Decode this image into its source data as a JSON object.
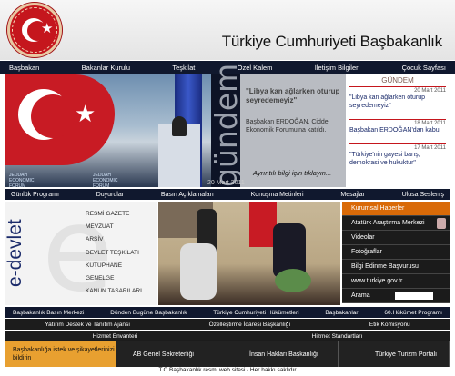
{
  "header": {
    "title": "Türkiye Cumhuriyeti Başbakanlık"
  },
  "nav": [
    "Başbakan",
    "Bakanlar Kurulu",
    "Teşkilat",
    "Özel Kalem",
    "İletişim Bilgileri",
    "Çocuk Sayfası"
  ],
  "gundem": {
    "vertical": "gündem",
    "headline": "\"Libya kan ağlarken oturup seyredemeyiz\"",
    "summary": "Başbakan ERDOĞAN, Cidde Ekonomik Forumu'na katıldı.",
    "more": "Ayrıntılı bilgi için tıklayın...",
    "date": "20 Mart 2011",
    "side_label": "GÜNDEM",
    "items": [
      {
        "date": "20 Mart 2011",
        "text": "\"Libya kan ağlarken oturup seyredemeyiz\""
      },
      {
        "date": "18 Mart 2011",
        "text": "Başbakan ERDOĞAN'dan kabul"
      },
      {
        "date": "17 Mart 2011",
        "text": "\"Türkiye'nin gayesi barış, demokrasi ve hukuktur\""
      }
    ]
  },
  "bar2": [
    "Günlük Programı",
    "Duyurular",
    "Basın Açıklamaları",
    "Konuşma Metinleri",
    "Mesajlar",
    "Ulusa Sesleniş"
  ],
  "edevlet": {
    "label": "e-devlet",
    "links": [
      "RESMİ GAZETE",
      "MEVZUAT",
      "ARŞİV",
      "DEVLET TEŞKİLATI",
      "KÜTÜPHANE",
      "GENELGE",
      "KANUN TASARILARI"
    ]
  },
  "rmenu": {
    "items": [
      "Kurumsal Haberler",
      "Atatürk Araştırma Merkezi",
      "Videolar",
      "Fotoğraflar",
      "Bilgi Edinme Başvurusu",
      "www.turkiye.gov.tr"
    ],
    "search_label": "Arama"
  },
  "bar3": [
    "Başbakanlık Basın Merkezi",
    "Dünden Bugüne Başbakanlık",
    "Türkiye Cumhuriyeti Hükümetleri",
    "Başbakanlar",
    "60.Hükümet Programı"
  ],
  "bar4": [
    "Yatırım Destek ve Tanıtım Ajansı",
    "Özelleştirme İdaresi Başkanlığı",
    "Etik Komisyonu"
  ],
  "bar5": [
    "Hizmet Envanteri",
    "Hizmet Standartları"
  ],
  "tiles": [
    "Başbakanlığa istek ve şikayetlerinizi bildirin",
    "AB Genel Sekreterliği",
    "İnsan Hakları Başkanlığı",
    "Türkiye Turizm Portalı"
  ],
  "footer": "T.C Başbakanlık resmi web sitesi / Her hakkı saklıdır"
}
